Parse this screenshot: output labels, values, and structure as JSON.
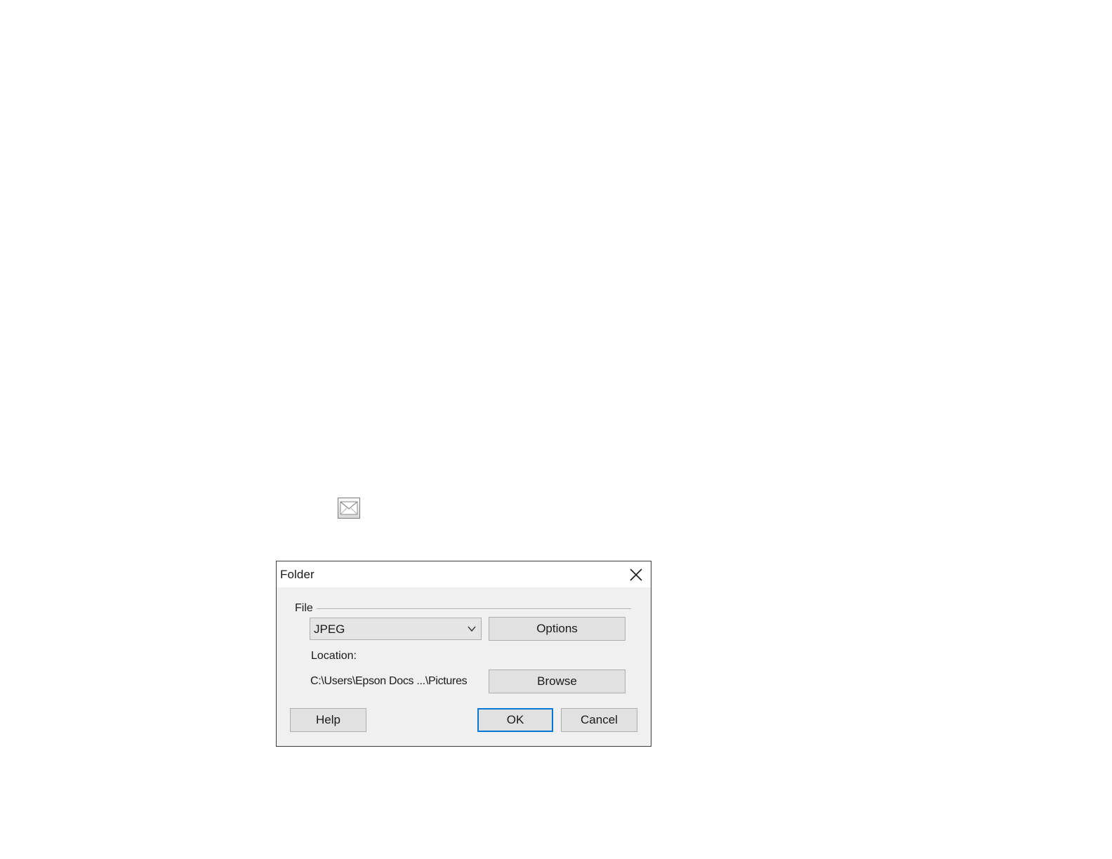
{
  "icons": {
    "mail_icon": "envelope-icon"
  },
  "dialog": {
    "title": "Folder",
    "close_icon": "close-icon",
    "file_group_label": "File",
    "file_type": {
      "selected": "JPEG"
    },
    "options_label": "Options",
    "location_label": "Location:",
    "location_path": "C:\\Users\\Epson Docs ...\\Pictures",
    "browse_label": "Browse",
    "help_label": "Help",
    "ok_label": "OK",
    "cancel_label": "Cancel"
  },
  "colors": {
    "focus_accent": "#0078d7",
    "dialog_background": "#f0f0f0",
    "button_background": "#e1e1e1"
  }
}
